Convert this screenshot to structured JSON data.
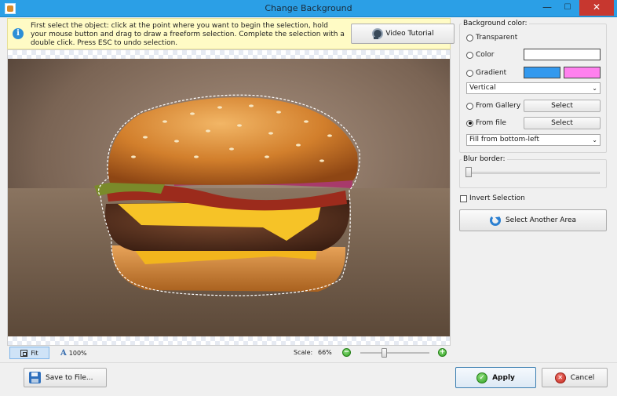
{
  "window": {
    "title": "Change Background",
    "minimize_glyph": "—",
    "maximize_glyph": "☐",
    "close_glyph": "✕"
  },
  "hint": {
    "icon": "info-icon",
    "text": "First select the object: click at the point where you want to begin the selection, hold your mouse button and drag to draw a freeform selection. Complete the selection with a double click. Press ESC to undo selection.",
    "video_button": "Video Tutorial"
  },
  "canvas": {
    "image_subject": "burger-photo",
    "fit_label": "Fit",
    "zoom_100_label": "100%",
    "scale_label": "Scale:",
    "scale_value": "66%",
    "zoom_out_glyph": "−",
    "zoom_in_glyph": "+",
    "zoom_slider_value": 0.4
  },
  "background_color": {
    "legend": "Background color:",
    "options": {
      "transparent": "Transparent",
      "color": "Color",
      "gradient": "Gradient",
      "from_gallery": "From Gallery",
      "from_file": "From file"
    },
    "selected": "from_file",
    "color_swatch": "#ffffff",
    "gradient_start": "#3399ee",
    "gradient_end": "#ff80ee",
    "gradient_direction": "Vertical",
    "gallery_button": "Select",
    "file_button": "Select",
    "fill_mode": "Fill from bottom-left"
  },
  "blur": {
    "legend": "Blur border:",
    "value": 0
  },
  "invert_selection": {
    "label": "Invert Selection",
    "checked": false
  },
  "select_another_area": "Select Another Area",
  "footer": {
    "save_button": "Save to File...",
    "apply_button": "Apply",
    "cancel_button": "Cancel"
  }
}
